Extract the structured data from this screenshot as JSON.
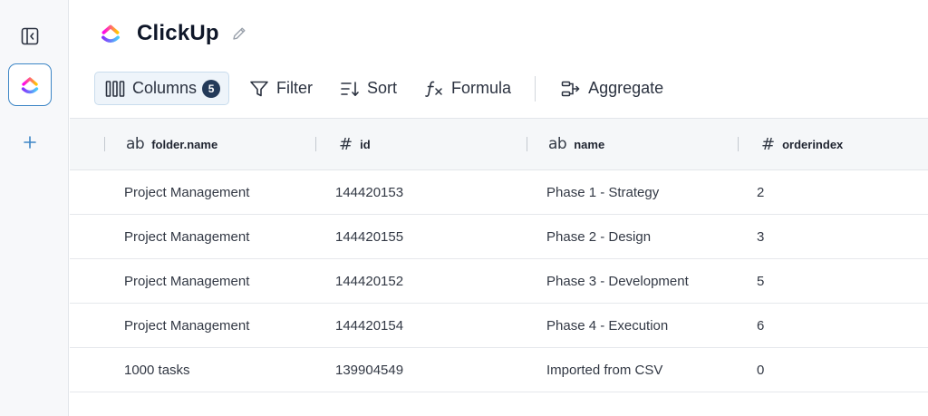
{
  "app": {
    "title": "ClickUp",
    "logo_colors": [
      "#8930fd",
      "#fa12e3",
      "#ffd700",
      "#49ccf9"
    ],
    "accent": "#3d86c6"
  },
  "sidebar": {
    "items": [
      {
        "name": "sidebar-toggle",
        "icon": "panel-collapse-icon"
      },
      {
        "name": "clickup-app",
        "icon": "clickup-logo-icon"
      },
      {
        "name": "add-source",
        "icon": "plus-icon"
      }
    ]
  },
  "toolbar": {
    "columns_label": "Columns",
    "columns_count": "5",
    "filter_label": "Filter",
    "sort_label": "Sort",
    "formula_label": "Formula",
    "aggregate_label": "Aggregate"
  },
  "table": {
    "columns": [
      {
        "type_icon": "ab",
        "label": "folder.name"
      },
      {
        "type_icon": "#",
        "label": "id"
      },
      {
        "type_icon": "ab",
        "label": "name"
      },
      {
        "type_icon": "#",
        "label": "orderindex"
      }
    ],
    "rows": [
      [
        "Project Management",
        "144420153",
        "Phase 1 - Strategy",
        "2"
      ],
      [
        "Project Management",
        "144420155",
        "Phase 2 - Design",
        "3"
      ],
      [
        "Project Management",
        "144420152",
        "Phase 3 - Development",
        "5"
      ],
      [
        "Project Management",
        "144420154",
        "Phase 4 - Execution",
        "6"
      ],
      [
        "1000 tasks",
        "139904549",
        "Imported from CSV",
        "0"
      ]
    ]
  }
}
